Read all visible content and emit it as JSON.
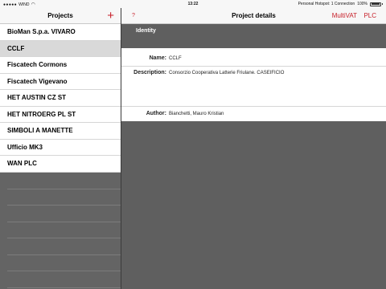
{
  "statusbar": {
    "carrier": "WIND",
    "time": "13:22",
    "hotspot": "Personal Hotspot: 1 Connection",
    "battery": "100%"
  },
  "left": {
    "title": "Projects",
    "add_label": "+",
    "projects": [
      "BioMan S.p.a. VIVARO",
      "CCLF",
      "Fiscatech Cormons",
      "Fiscatech Vigevano",
      "HET AUSTIN CZ ST",
      "HET NITROERG PL ST",
      "SIMBOLI A MANETTE",
      "Ufficio MK3",
      "WAN PLC"
    ],
    "selected_index": 1
  },
  "right": {
    "help_label": "?",
    "title": "Project details",
    "multivat_label": "MultiVAT",
    "plc_label": "PLC",
    "section_title": "Identity",
    "name_label": "Name:",
    "name_value": "CCLF",
    "description_label": "Description:",
    "description_value": "Consorzio Cooperativa Latterie Friulane. CASEIFICIO",
    "author_label": "Author:",
    "author_value": "Bianchetti, Mauro Kristian"
  },
  "colors": {
    "accent": "#c7202a",
    "dark_background": "#5f5f5f",
    "selected_row": "#d9d9d9"
  }
}
